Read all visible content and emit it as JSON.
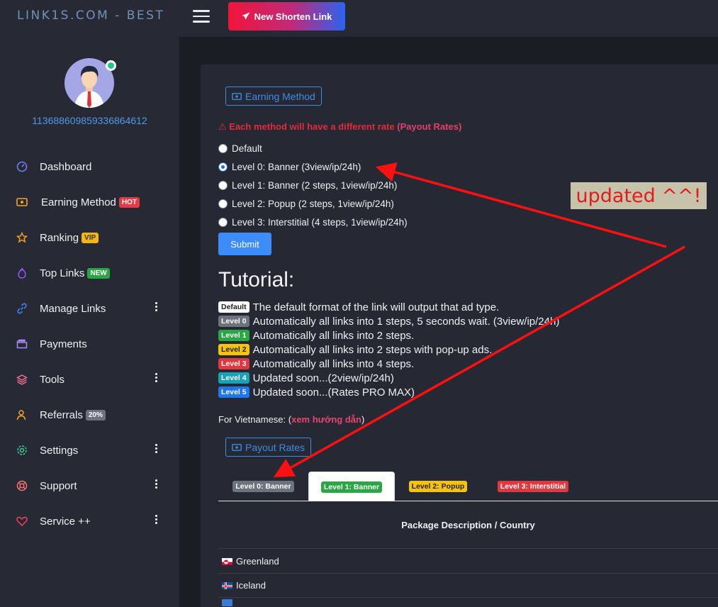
{
  "brand": "LINK1S.COM - BEST",
  "header": {
    "new_button": "New Shorten Link"
  },
  "user": {
    "id": "113688609859336864612"
  },
  "sidebar": {
    "items": [
      {
        "label": "Dashboard",
        "icon": "gauge-icon",
        "badge": ""
      },
      {
        "label": "Earning Method",
        "icon": "money-icon",
        "badge": "HOT"
      },
      {
        "label": "Ranking",
        "icon": "star-icon",
        "badge": "VIP"
      },
      {
        "label": "Top Links",
        "icon": "fire-icon",
        "badge": "NEW"
      },
      {
        "label": "Manage Links",
        "icon": "link-icon",
        "badge": ""
      },
      {
        "label": "Payments",
        "icon": "wallet-icon",
        "badge": ""
      },
      {
        "label": "Tools",
        "icon": "layers-icon",
        "badge": ""
      },
      {
        "label": "Referrals",
        "icon": "users-icon",
        "badge": "20%"
      },
      {
        "label": "Settings",
        "icon": "gear-icon",
        "badge": ""
      },
      {
        "label": "Support",
        "icon": "lifebuoy-icon",
        "badge": ""
      },
      {
        "label": "Service ++",
        "icon": "heart-icon",
        "badge": ""
      }
    ]
  },
  "earning": {
    "title": "Earning Method",
    "warning": "Each method will have a different rate",
    "warning_link": "(Payout Rates)",
    "options": [
      "Default",
      "Level 0: Banner (3view/ip/24h)",
      "Level 1: Banner (2 steps, 1view/ip/24h)",
      "Level 2: Popup (2 steps, 1view/ip/24h)",
      "Level 3: Interstitial (4 steps, 1view/ip/24h)"
    ],
    "selected_index": 1,
    "submit": "Submit"
  },
  "tutorial": {
    "title": "Tutorial:",
    "rows": [
      {
        "badge": "Default",
        "text": "The default format of the link will output that ad type."
      },
      {
        "badge": "Level 0",
        "text": "Automatically all links into 1 steps, 5 seconds wait. (3view/ip/24h)"
      },
      {
        "badge": "Level 1",
        "text": "Automatically all links into 2 steps."
      },
      {
        "badge": "Level 2",
        "text": "Automatically all links into 2 steps with pop-up ads."
      },
      {
        "badge": "Level 3",
        "text": "Automatically all links into 4 steps."
      },
      {
        "badge": "Level 4",
        "text": "Updated soon...(2view/ip/24h)"
      },
      {
        "badge": "Level 5",
        "text": "Updated soon...(Rates PRO MAX)"
      }
    ],
    "viet_prefix": "For Vietnamese: (",
    "viet_link": "xem hướng dẫn",
    "viet_suffix": ")"
  },
  "payout": {
    "title": "Payout Rates",
    "tabs": [
      "Level 0: Banner",
      "Level 1: Banner",
      "Level 2: Popup",
      "Level 3: Interstitial"
    ],
    "active_tab": 1,
    "column_header": "Package Description / Country",
    "countries": [
      "Greenland",
      "Iceland"
    ]
  },
  "annotation": {
    "text": "updated ^^!"
  },
  "colors": {
    "accent": "#3c8de6",
    "danger": "#e42a3a",
    "sidebar_bg": "#272935",
    "card_bg": "#262833"
  }
}
